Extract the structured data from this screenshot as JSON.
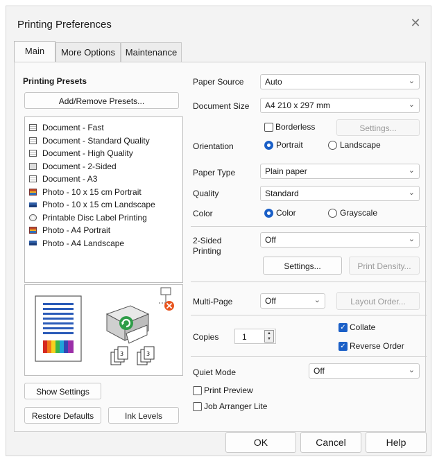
{
  "window": {
    "title": "Printing Preferences",
    "close_glyph": "✕"
  },
  "tabs": [
    {
      "label": "Main",
      "active": true
    },
    {
      "label": "More Options",
      "active": false
    },
    {
      "label": "Maintenance",
      "active": false
    }
  ],
  "presets": {
    "title": "Printing Presets",
    "add_remove_label": "Add/Remove Presets...",
    "items": [
      {
        "label": "Document - Fast",
        "icon": "document-icon"
      },
      {
        "label": "Document - Standard Quality",
        "icon": "document-icon"
      },
      {
        "label": "Document - High Quality",
        "icon": "document-icon"
      },
      {
        "label": "Document - 2-Sided",
        "icon": "two-sided-document-icon"
      },
      {
        "label": "Document - A3",
        "icon": "document-icon"
      },
      {
        "label": "Photo - 10 x 15 cm Portrait",
        "icon": "photo-portrait-icon"
      },
      {
        "label": "Photo - 10 x 15 cm Landscape",
        "icon": "photo-landscape-icon"
      },
      {
        "label": "Printable Disc Label Printing",
        "icon": "disc-icon"
      },
      {
        "label": "Photo - A4 Portrait",
        "icon": "photo-portrait-icon"
      },
      {
        "label": "Photo - A4 Landscape",
        "icon": "photo-landscape-icon"
      }
    ],
    "show_settings_label": "Show Settings",
    "restore_defaults_label": "Restore Defaults",
    "ink_levels_label": "Ink Levels"
  },
  "settings": {
    "paper_source_label": "Paper Source",
    "paper_source_value": "Auto",
    "document_size_label": "Document Size",
    "document_size_value": "A4 210 x 297 mm",
    "borderless_label": "Borderless",
    "borderless_checked": false,
    "borderless_settings_label": "Settings...",
    "orientation_label": "Orientation",
    "portrait_label": "Portrait",
    "landscape_label": "Landscape",
    "orientation_selected": "Portrait",
    "paper_type_label": "Paper Type",
    "paper_type_value": "Plain paper",
    "quality_label": "Quality",
    "quality_value": "Standard",
    "color_label": "Color",
    "color_option_label": "Color",
    "grayscale_label": "Grayscale",
    "color_selected": "Color",
    "two_sided_label_line1": "2-Sided",
    "two_sided_label_line2": "Printing",
    "two_sided_value": "Off",
    "two_sided_settings_label": "Settings...",
    "print_density_label": "Print Density...",
    "multi_page_label": "Multi-Page",
    "multi_page_value": "Off",
    "layout_order_label": "Layout Order...",
    "copies_label": "Copies",
    "copies_value": "1",
    "collate_label": "Collate",
    "collate_checked": true,
    "reverse_order_label": "Reverse Order",
    "reverse_order_checked": true,
    "quiet_mode_label": "Quiet Mode",
    "quiet_mode_value": "Off",
    "print_preview_label": "Print Preview",
    "print_preview_checked": false,
    "job_arranger_label": "Job Arranger Lite",
    "job_arranger_checked": false
  },
  "footer": {
    "ok_label": "OK",
    "cancel_label": "Cancel",
    "help_label": "Help"
  },
  "colors": {
    "accent": "#1a5fc7",
    "ink_warning": "#e8541e"
  }
}
